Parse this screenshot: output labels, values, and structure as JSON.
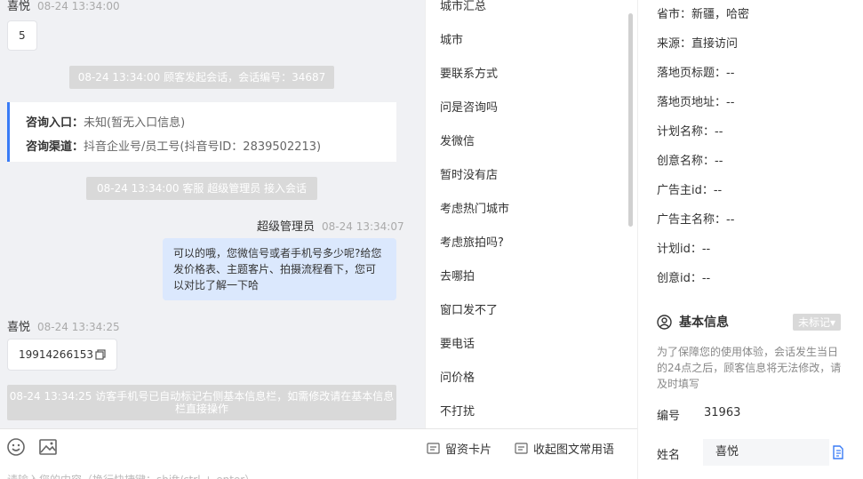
{
  "chat": {
    "msg1": {
      "sender": "喜悦",
      "time": "08-24 13:34:00",
      "text": "5"
    },
    "sys1": "08-24 13:34:00 顾客发起会话，会话编号：34687",
    "card": {
      "entry_key": "咨询入口：",
      "entry_val": "未知(暂无入口信息)",
      "channel_key": "咨询渠道：",
      "channel_val": "抖音企业号/员工号(抖音号ID：2839502213)"
    },
    "sys2": "08-24 13:34:00 客服 超级管理员 接入会话",
    "msg2": {
      "sender": "超级管理员",
      "time": "08-24 13:34:07",
      "text": "可以的哦，您微信号或者手机号多少呢?给您发价格表、主题客片、拍摄流程看下，您可以对比了解一下哈"
    },
    "msg3": {
      "sender": "喜悦",
      "time": "08-24 13:34:25",
      "text": "19914266153"
    },
    "sys3": "08-24 13:34:25 访客手机号已自动标记右侧基本信息栏，如需修改请在基本信息栏直接操作"
  },
  "inputbar": {
    "placeholder": "请输入您的内容（换行快捷键：shift/ctrl + enter）",
    "leave_card": "留资卡片",
    "collapse": "收起图文常用语"
  },
  "quick_replies": [
    "城市汇总",
    "城市",
    "要联系方式",
    "问是咨询吗",
    "发微信",
    "暂时没有店",
    "考虑热门城市",
    "考虑旅拍吗?",
    "去哪拍",
    "窗口发不了",
    "要电话",
    "问价格",
    "不打扰"
  ],
  "info": {
    "fields": [
      "省市：新疆，哈密",
      "来源：直接访问",
      "落地页标题：--",
      "落地页地址：--",
      "计划名称：--",
      "创意名称：--",
      "广告主id：--",
      "广告主名称：--",
      "计划id：--",
      "创意id：--"
    ],
    "basic_title": "基本信息",
    "tag": "未标记▾",
    "note": "为了保障您的使用体验，会话发生当日的24点之后，顾客信息将无法修改，请及时填写",
    "id_label": "编号",
    "id_value": "31963",
    "name_label": "姓名",
    "name_value": "喜悦"
  },
  "colors": {
    "accent": "#3a7cf6",
    "bubble_right": "#dbe8fd",
    "system_bg": "#d9d9d9"
  }
}
